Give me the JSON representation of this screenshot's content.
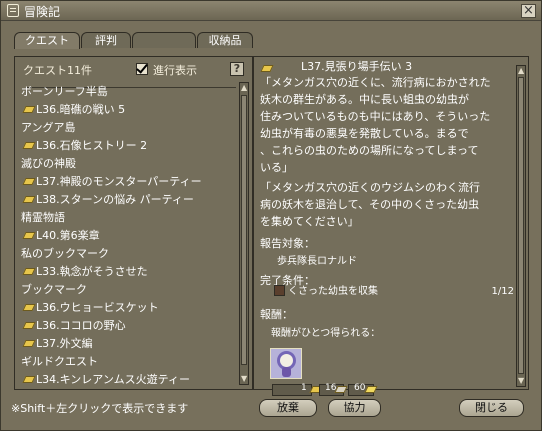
{
  "window": {
    "title": "冒険記",
    "close": "×"
  },
  "tabs": [
    {
      "label": "クエスト",
      "state": "active"
    },
    {
      "label": "評判",
      "state": "normal"
    },
    {
      "label": "",
      "state": "disabled"
    },
    {
      "label": "収納品",
      "state": "normal"
    }
  ],
  "list_header": {
    "count": "クエスト11件",
    "progress": "進行表示",
    "help": "?"
  },
  "quest_list": [
    {
      "type": "cat",
      "label": "ボーンリーフ半島"
    },
    {
      "type": "q",
      "label": "L36.暗礁の戦い 5"
    },
    {
      "type": "cat",
      "label": "アングア島"
    },
    {
      "type": "q",
      "label": "L36.石像ヒストリー 2"
    },
    {
      "type": "cat",
      "label": "滅びの神殿"
    },
    {
      "type": "q",
      "label": "L37.神殿のモンスターパーティー"
    },
    {
      "type": "q",
      "label": "L38.スターンの悩み パーティー"
    },
    {
      "type": "cat",
      "label": "精霊物語"
    },
    {
      "type": "q",
      "label": "L40.第6楽章"
    },
    {
      "type": "cat",
      "label": "私のブックマーク"
    },
    {
      "type": "q",
      "label": "L33.執念がそうさせた"
    },
    {
      "type": "cat",
      "label": "ブックマーク"
    },
    {
      "type": "q",
      "label": "L36.ウヒョービスケット"
    },
    {
      "type": "q",
      "label": "L36.ココロの野心"
    },
    {
      "type": "q",
      "label": "L37.外文編"
    },
    {
      "type": "cat",
      "label": "ギルドクエスト"
    },
    {
      "type": "q",
      "label": "L34.キンレアンムス火遊ティー"
    }
  ],
  "detail": {
    "quest_title": "L37.見張り場手伝い 3",
    "description": "「メタンガス穴の近くに、流行病におかされた\n妖木の群生がある。中に長い蛆虫の幼虫が\n住みついているものも中にはあり、そういった\n幼虫が有毒の悪臭を発散している。まるで\n、これらの虫のための場所になってしまって\nいる」",
    "request": "「メタンガス穴の近くのウジムシのわく流行\n病の妖木を退治して、その中のくさった幼虫\nを集めてください」",
    "report_title": "報告対象：",
    "report_name": "歩兵隊長ロナルド",
    "condition_title": "完了条件：",
    "condition_text": "くさった幼虫を収集",
    "condition_count": "1/12",
    "reward_title": "報酬：",
    "reward_text": "報酬がひとつ得られる：",
    "item_values": [
      "1",
      "16",
      "60"
    ]
  },
  "footer": {
    "hint": "※Shift＋左クリックで表示できます",
    "give_up": "放棄",
    "cooperate": "協力",
    "close": "閉じる"
  }
}
